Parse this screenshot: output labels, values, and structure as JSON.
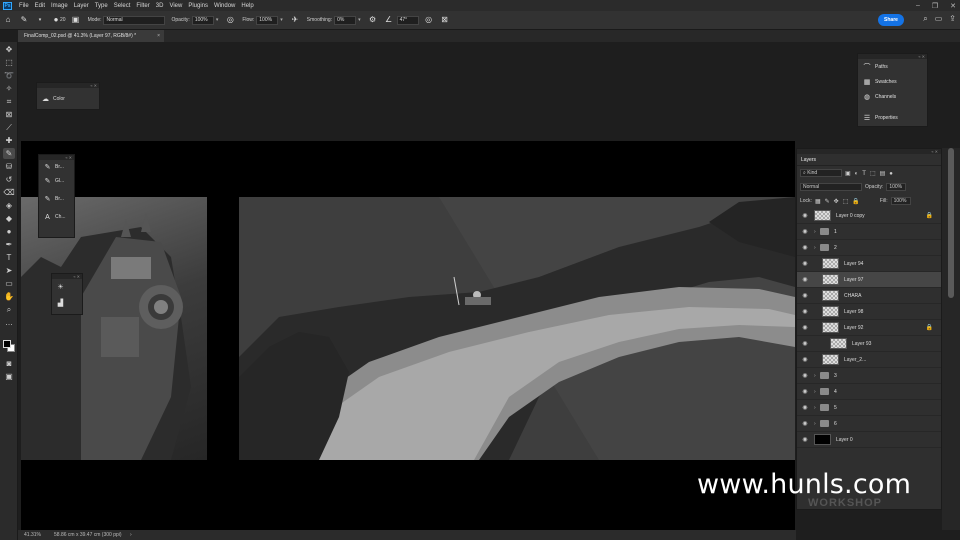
{
  "app": {
    "logo": "Ps"
  },
  "menu": [
    "File",
    "Edit",
    "Image",
    "Layer",
    "Type",
    "Select",
    "Filter",
    "3D",
    "View",
    "Plugins",
    "Window",
    "Help"
  ],
  "options": {
    "brush_size": "20",
    "mode_label": "Mode:",
    "mode_value": "Normal",
    "opacity_label": "Opacity:",
    "opacity_value": "100%",
    "flow_label": "Flow:",
    "flow_value": "100%",
    "smoothing_label": "Smoothing:",
    "smoothing_value": "0%",
    "angle_value": "47°",
    "share_label": "Share"
  },
  "document": {
    "tab_title": "FinalComp_02.psd @ 41.3% (Layer 97, RGB/8#) *"
  },
  "color_panel": {
    "label": "Color"
  },
  "brush_panel": {
    "items": [
      "Br...",
      "Gl...",
      "Br...",
      "Ch..."
    ]
  },
  "right_panel": {
    "items": [
      "Paths",
      "Swatches",
      "Channels",
      "Properties"
    ]
  },
  "layers_panel": {
    "title": "Layers",
    "filter_value": "Kind",
    "blend_mode": "Normal",
    "opacity_label": "Opacity:",
    "opacity_value": "100%",
    "lock_label": "Lock:",
    "fill_label": "Fill:",
    "fill_value": "100%",
    "rows": [
      {
        "name": "Layer 0 copy",
        "type": "layer",
        "indent": 0,
        "locked": true,
        "selected": false
      },
      {
        "name": "1",
        "type": "group",
        "indent": 0,
        "locked": false,
        "selected": false
      },
      {
        "name": "2",
        "type": "group",
        "indent": 0,
        "locked": false,
        "selected": false
      },
      {
        "name": "Layer 94",
        "type": "layer",
        "indent": 1,
        "locked": false,
        "selected": false
      },
      {
        "name": "Layer 97",
        "type": "layer",
        "indent": 1,
        "locked": false,
        "selected": true
      },
      {
        "name": "CHARA",
        "type": "layer",
        "indent": 1,
        "locked": false,
        "selected": false
      },
      {
        "name": "Layer 98",
        "type": "layer",
        "indent": 1,
        "locked": false,
        "selected": false
      },
      {
        "name": "Layer 92",
        "type": "layer",
        "indent": 1,
        "locked": true,
        "selected": false
      },
      {
        "name": "Layer 93",
        "type": "layer",
        "indent": 2,
        "locked": false,
        "selected": false
      },
      {
        "name": "Layer_2...",
        "type": "layer",
        "indent": 1,
        "locked": false,
        "selected": false
      },
      {
        "name": "3",
        "type": "group",
        "indent": 0,
        "locked": false,
        "selected": false
      },
      {
        "name": "4",
        "type": "group",
        "indent": 0,
        "locked": false,
        "selected": false
      },
      {
        "name": "5",
        "type": "group",
        "indent": 0,
        "locked": false,
        "selected": false
      },
      {
        "name": "6",
        "type": "group",
        "indent": 0,
        "locked": false,
        "selected": false
      },
      {
        "name": "Layer 0",
        "type": "layer-black",
        "indent": 0,
        "locked": false,
        "selected": false
      }
    ]
  },
  "status": {
    "zoom": "41.31%",
    "dims": "58.86 cm x 39.47 cm (300 ppi)"
  },
  "watermark": {
    "text": "www.hunls.com",
    "logo_text": "WORKSHOP"
  },
  "colors": {
    "share": "#1473e6",
    "panel": "#323232",
    "canvas_bg": "#1e1e1e"
  }
}
